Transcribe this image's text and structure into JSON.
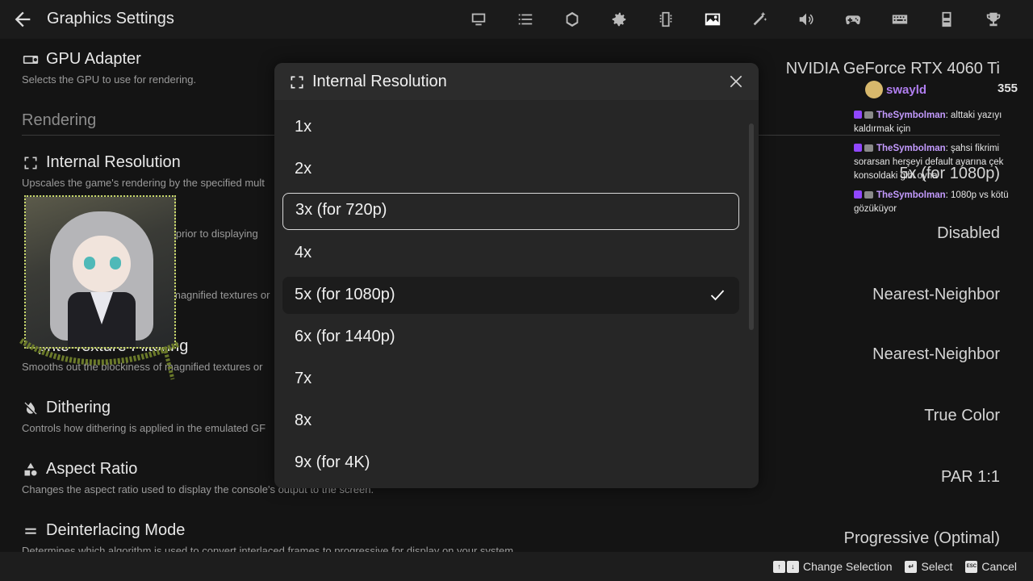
{
  "header": {
    "title": "Graphics Settings"
  },
  "topbar_icons": [
    "monitor-icon",
    "list-icon",
    "emblem-icon",
    "gear-icon",
    "memory-card-icon",
    "image-icon",
    "magic-wand-icon",
    "speaker-icon",
    "gamepad-icon",
    "keyboard-icon",
    "device-icon",
    "trophy-icon"
  ],
  "settings": {
    "gpu": {
      "label": "GPU Adapter",
      "icon_label": "GPU",
      "desc": "Selects the GPU to use for rendering.",
      "value": "NVIDIA GeForce RTX 4060 Ti"
    },
    "rendering_heading": "Rendering",
    "internal_res": {
      "label": "Internal Resolution",
      "desc": "Upscales the game's rendering by the specified mult",
      "value": "5x (for 1080p)"
    },
    "row3": {
      "desc": "e prior to displaying",
      "value": "Disabled"
    },
    "row4": {
      "desc": "magnified textures or",
      "value": "Nearest-Neighbor"
    },
    "sprite": {
      "label": "prite Texture Filtering",
      "desc": "Smooths out the blockiness of magnified textures or",
      "value": "Nearest-Neighbor"
    },
    "dithering": {
      "label": "Dithering",
      "desc": "Controls how dithering is applied in the emulated GF",
      "value": "True Color"
    },
    "aspect": {
      "label": "Aspect Ratio",
      "desc": "Changes the aspect ratio used to display the console's output to the screen.",
      "value": "PAR 1:1"
    },
    "deinterlace": {
      "label": "Deinterlacing Mode",
      "desc": "Determines which algorithm is used to convert interlaced frames to progressive for display on your system.",
      "value": "Progressive (Optimal)"
    }
  },
  "modal": {
    "title": "Internal Resolution",
    "options": [
      "1x",
      "2x",
      "3x (for 720p)",
      "4x",
      "5x (for 1080p)",
      "6x (for 1440p)",
      "7x",
      "8x",
      "9x (for 4K)"
    ],
    "focused_index": 2,
    "selected_index": 4
  },
  "stream": {
    "viewer_name": "swayld",
    "viewer_count": "355",
    "chat": [
      {
        "user": "TheSymbolman",
        "text": ": alttaki yazıyı kaldırmak için"
      },
      {
        "user": "TheSymbolman",
        "text": ": şahsi fikrimi sorarsan herşeyi default ayarına çek konsoldaki gibi oyna"
      },
      {
        "user": "TheSymbolman",
        "text": ": 1080p vs kötü gözüküyor"
      }
    ]
  },
  "hints": {
    "change": "Change Selection",
    "select": "Select",
    "cancel": "Cancel",
    "cancel_key": "ESC"
  }
}
